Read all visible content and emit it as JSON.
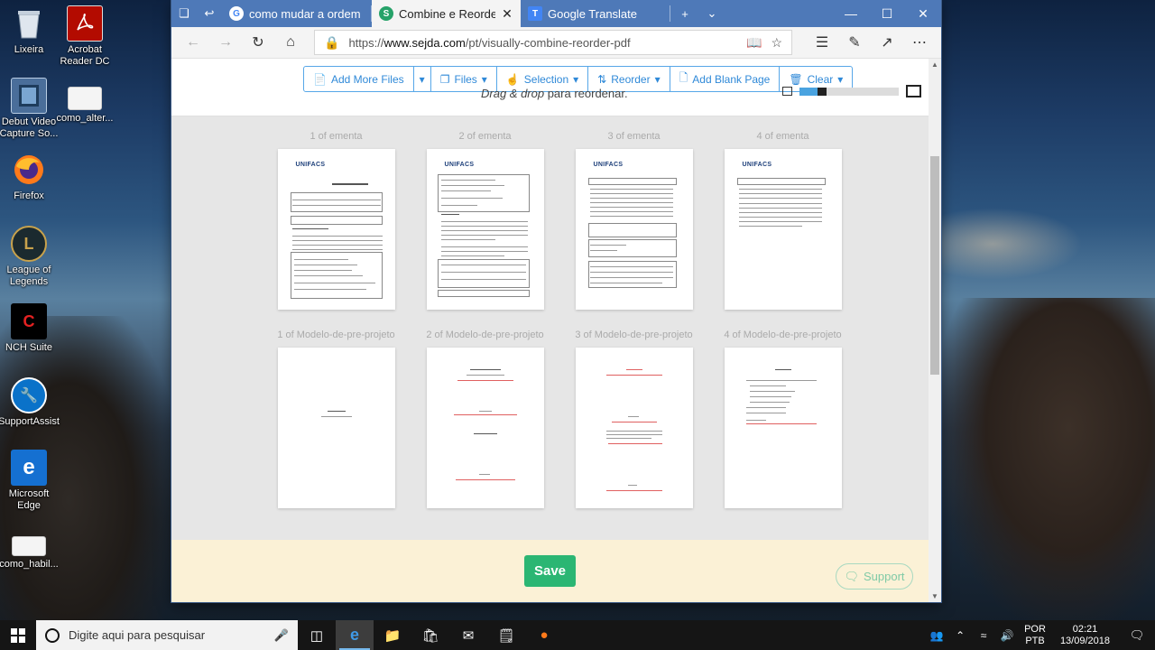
{
  "desktop": {
    "icons": [
      {
        "label": "Lixeira",
        "icon": "recycle-bin-icon"
      },
      {
        "label": "Acrobat Reader DC",
        "icon": "acrobat-icon"
      },
      {
        "label": "Debut Video Capture So...",
        "icon": "debut-icon"
      },
      {
        "label": "como_alter...",
        "icon": "document-icon"
      },
      {
        "label": "Firefox",
        "icon": "firefox-icon"
      },
      {
        "label": "League of Legends",
        "icon": "league-icon"
      },
      {
        "label": "NCH Suite",
        "icon": "nch-icon"
      },
      {
        "label": "SupportAssist",
        "icon": "wrench-icon"
      },
      {
        "label": "Microsoft Edge",
        "icon": "edge-icon"
      },
      {
        "label": "como_habil...",
        "icon": "document-icon"
      }
    ]
  },
  "browser": {
    "tabs": [
      {
        "title": "como mudar a ordem das p",
        "favicon": "G",
        "active": false
      },
      {
        "title": "Combine e Reordene Vi",
        "favicon": "S",
        "active": true
      },
      {
        "title": "Google Translate",
        "favicon": "T",
        "active": false
      }
    ],
    "address": {
      "prefix": "https://",
      "domain": "www.sejda.com",
      "path": "/pt/visually-combine-reorder-pdf"
    }
  },
  "toolbar": {
    "add_more_files": "Add More Files",
    "files": "Files",
    "selection": "Selection",
    "reorder": "Reorder",
    "add_blank_page": "Add Blank Page",
    "clear": "Clear"
  },
  "hint": {
    "emph": "Drag & drop",
    "rest": " para reordenar."
  },
  "zoom": {
    "level": 0.18
  },
  "pages": [
    {
      "label": "1 of ementa",
      "kind": "ementa1"
    },
    {
      "label": "2 of ementa",
      "kind": "ementa2"
    },
    {
      "label": "3 of ementa",
      "kind": "ementa3"
    },
    {
      "label": "4 of ementa",
      "kind": "ementa4"
    },
    {
      "label": "1 of Modelo-de-pre-projeto",
      "kind": "modelo1"
    },
    {
      "label": "2 of Modelo-de-pre-projeto",
      "kind": "modelo2"
    },
    {
      "label": "3 of Modelo-de-pre-projeto",
      "kind": "modelo3"
    },
    {
      "label": "4 of Modelo-de-pre-projeto",
      "kind": "modelo4"
    }
  ],
  "thumb_text": {
    "logo": "UNIFACS",
    "plan_title": "PLANO DE ENSINO"
  },
  "actions": {
    "save": "Save",
    "support": "Support"
  },
  "taskbar": {
    "search_placeholder": "Digite aqui para pesquisar",
    "lang_top": "POR",
    "lang_bottom": "PTB",
    "time": "02:21",
    "date": "13/09/2018"
  }
}
